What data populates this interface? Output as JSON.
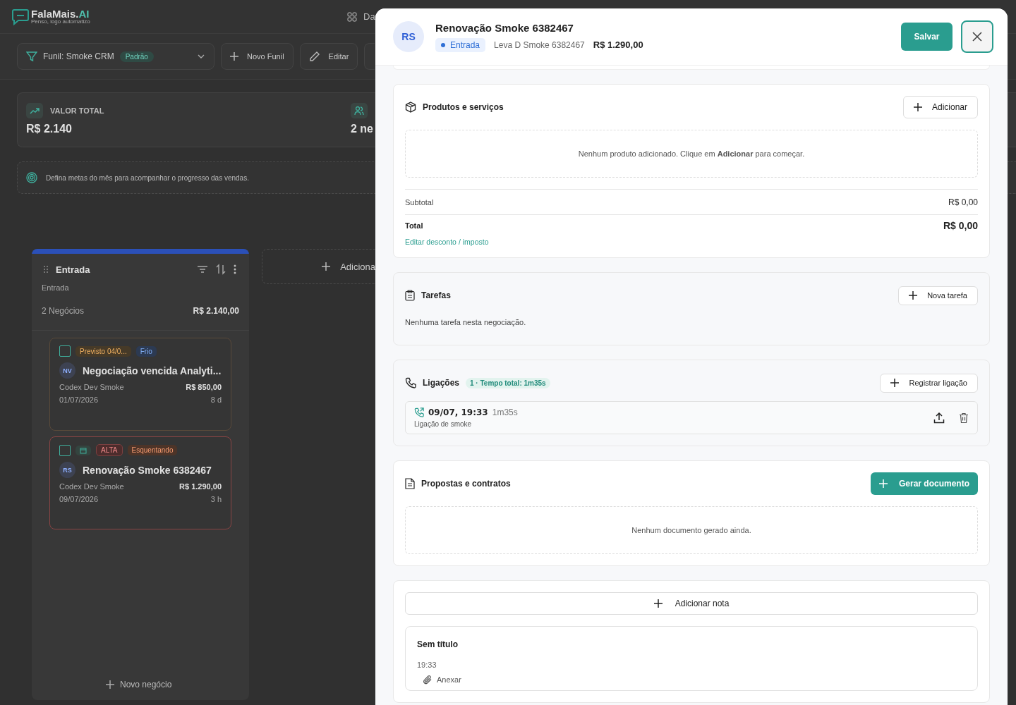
{
  "app": {
    "brand": "FalaMais.",
    "brand_accent": "AI",
    "tagline": "Penso, logo automatizo",
    "nav_item": "Da"
  },
  "toolbar": {
    "funnel": "Funil: Smoke CRM",
    "funnel_badge": "Padrão",
    "buttons": [
      {
        "label": "Novo Funil",
        "kind": "plus"
      },
      {
        "label": "Editar",
        "kind": "pencil"
      }
    ]
  },
  "stats": [
    {
      "label": "VALOR TOTAL",
      "value": "R$ 2.140",
      "kind": "trend"
    },
    {
      "value": "2 ne",
      "kind": "people"
    }
  ],
  "goals_hint": "Defina metas do mês para acompanhar o progresso das vendas.",
  "column": {
    "title": "Entrada",
    "subtitle": "Entrada",
    "count": "2 Negócios",
    "total": "R$ 2.140,00",
    "new_deal": "Novo negócio",
    "deals": [
      {
        "checked": false,
        "tags": [
          {
            "text": "Previsto 04/0...",
            "kind": "forecast"
          },
          {
            "text": "Frio",
            "kind": "cold"
          }
        ],
        "initials": "NV",
        "title": "Negociação vencida Analyti...",
        "owner": "Codex Dev Smoke",
        "value": "R$ 850,00",
        "date": "01/07/2026",
        "age": "8 d",
        "alert": false
      },
      {
        "checked": false,
        "tags": [
          {
            "kind": "date"
          },
          {
            "text": "ALTA",
            "kind": "priority"
          },
          {
            "text": "Esquentando",
            "kind": "warm"
          }
        ],
        "initials": "RS",
        "title": "Renovação Smoke 6382467",
        "owner": "Codex Dev Smoke",
        "value": "R$ 1.290,00",
        "date": "09/07/2026",
        "age": "3 h",
        "alert": true
      }
    ]
  },
  "add_column": "Adiciona",
  "modal": {
    "initials": "RS",
    "title": "Renovação Smoke 6382467",
    "stage": "Entrada",
    "lead": "Leva D Smoke 6382467",
    "amount": "R$ 1.290,00",
    "save": "Salvar",
    "products": {
      "title": "Produtos e serviços",
      "add": "Adicionar",
      "empty": "Nenhum produto adicionado. Clique em **Adicionar** para começar.",
      "subtotal_label": "Subtotal",
      "subtotal": "R$ 0,00",
      "total_label": "Total",
      "total": "R$ 0,00",
      "edit_link": "Editar desconto / imposto"
    },
    "tasks": {
      "title": "Tarefas",
      "add": "Nova tarefa",
      "empty": "Nenhuma tarefa nesta negociação."
    },
    "calls": {
      "title": "Ligações",
      "badge": "1 · Tempo total: 1m35s",
      "add": "Registrar ligação",
      "items": [
        {
          "when": "09/07, 19:33",
          "duration": "1m35s",
          "note": "Ligação de smoke"
        }
      ]
    },
    "proposals": {
      "title": "Propostas e contratos",
      "add": "Gerar documento",
      "empty": "Nenhum documento gerado ainda."
    },
    "notes": {
      "add": "Adicionar nota",
      "items": [
        {
          "title": "Sem título",
          "time": "19:33",
          "attach": "Anexar"
        }
      ]
    }
  }
}
